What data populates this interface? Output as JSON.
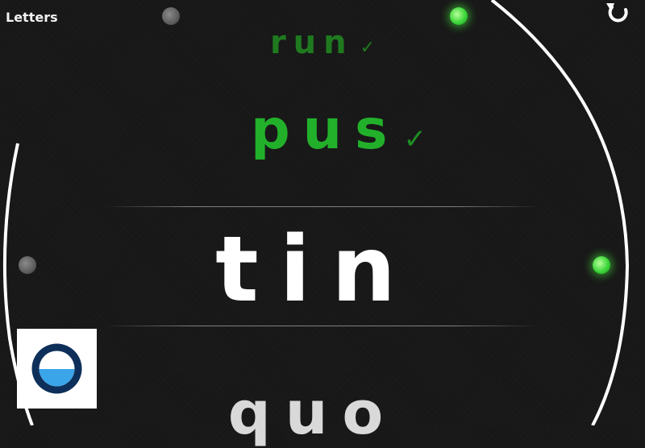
{
  "app": {
    "title": "Letters"
  },
  "toolbar": {
    "refresh_icon": "refresh-icon"
  },
  "words": [
    {
      "text": "run",
      "check": "✓",
      "state": "solved"
    },
    {
      "text": "pus",
      "check": "✓",
      "state": "solved"
    },
    {
      "text": "tin",
      "state": "current"
    },
    {
      "text": "quo",
      "state": "upcoming"
    }
  ],
  "colors": {
    "background": "#151515",
    "ring": "#ffffff",
    "solved_dim": "#1f7a1f",
    "solved": "#22b02b",
    "current": "#ffffff",
    "indicator_on": "#3cd63a",
    "indicator_off": "#6a6a6a",
    "logo_ring": "#0e2f5a",
    "logo_fill": "#3aa5e8"
  },
  "indicators": [
    {
      "name": "top-left",
      "state": "off"
    },
    {
      "name": "top-right",
      "state": "on"
    },
    {
      "name": "middle-left",
      "state": "off"
    },
    {
      "name": "middle-right",
      "state": "on"
    }
  ]
}
